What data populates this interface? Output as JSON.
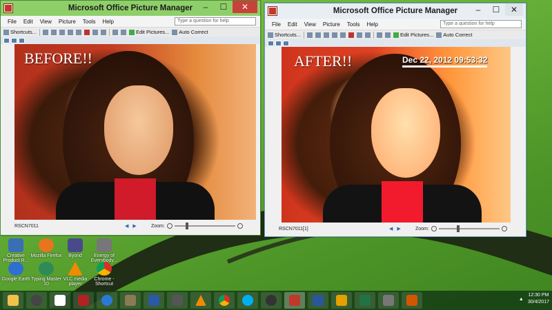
{
  "windows": [
    {
      "title": "Microsoft Office Picture Manager",
      "menu": [
        "File",
        "Edit",
        "View",
        "Picture",
        "Tools",
        "Help"
      ],
      "help_placeholder": "Type a question for help",
      "toolbar": {
        "shortcuts": "Shortcuts...",
        "edit_pictures": "Edit Pictures...",
        "auto_correct": "Auto Correct"
      },
      "overlay_text": "BEFORE!!",
      "timestamp": "",
      "filename": "RSCN7011",
      "zoom_label": "Zoom:"
    },
    {
      "title": "Microsoft Office Picture Manager",
      "menu": [
        "File",
        "Edit",
        "View",
        "Picture",
        "Tools",
        "Help"
      ],
      "help_placeholder": "Type a question for help",
      "toolbar": {
        "shortcuts": "Shortcuts...",
        "edit_pictures": "Edit Pictures...",
        "auto_correct": "Auto Correct"
      },
      "overlay_text": "AFTER!!",
      "timestamp": "Dec 22, 2012 09:53:32",
      "filename": "RSCN7011[1]",
      "zoom_label": "Zoom:"
    }
  ],
  "desktop_icons": [
    {
      "label": "Creative Product R...",
      "icon": "creative-icon",
      "color": "#3a6fb5"
    },
    {
      "label": "Mozilla Firefox",
      "icon": "firefox-icon",
      "color": "#e8741f"
    },
    {
      "label": "Byond",
      "icon": "byond-icon",
      "color": "#4a4a8a"
    },
    {
      "label": "Energy of Everybody...",
      "icon": "energy-icon",
      "color": "#777777"
    },
    {
      "label": "Google Earth",
      "icon": "google-earth-icon",
      "color": "#2f6fd0"
    },
    {
      "label": "Typing Master 10",
      "icon": "typing-master-icon",
      "color": "#2e8b57"
    },
    {
      "label": "VLC media player",
      "icon": "vlc-icon",
      "color": "#f08a00"
    },
    {
      "label": "Chrome - Shortcut",
      "icon": "chrome-icon",
      "color": "#d93025"
    }
  ],
  "taskbar": {
    "apps": [
      {
        "name": "file-explorer-icon",
        "color": "#f2c24b"
      },
      {
        "name": "media-icon",
        "color": "#444444"
      },
      {
        "name": "amazon-icon",
        "color": "#ffffff"
      },
      {
        "name": "power-icon",
        "color": "#b22222"
      },
      {
        "name": "ie-icon",
        "color": "#2a7ad5"
      },
      {
        "name": "scanner-icon",
        "color": "#8a7a55"
      },
      {
        "name": "calculator-icon",
        "color": "#2a5aa5"
      },
      {
        "name": "film-icon",
        "color": "#555555"
      },
      {
        "name": "vlc-taskbar-icon",
        "color": "#f08a00"
      },
      {
        "name": "chrome-taskbar-icon",
        "color": "#d93025"
      },
      {
        "name": "skype-icon",
        "color": "#00aff0"
      },
      {
        "name": "speedtest-icon",
        "color": "#333333"
      },
      {
        "name": "picture-manager-icon",
        "color": "#c0392b"
      },
      {
        "name": "word-icon",
        "color": "#2b579a"
      },
      {
        "name": "paint-icon",
        "color": "#e5a000"
      },
      {
        "name": "excel-icon",
        "color": "#217346"
      },
      {
        "name": "tools-icon",
        "color": "#777777"
      },
      {
        "name": "video-icon",
        "color": "#d45500"
      }
    ],
    "time": "12:30 PM",
    "date": "30/4/2017"
  }
}
